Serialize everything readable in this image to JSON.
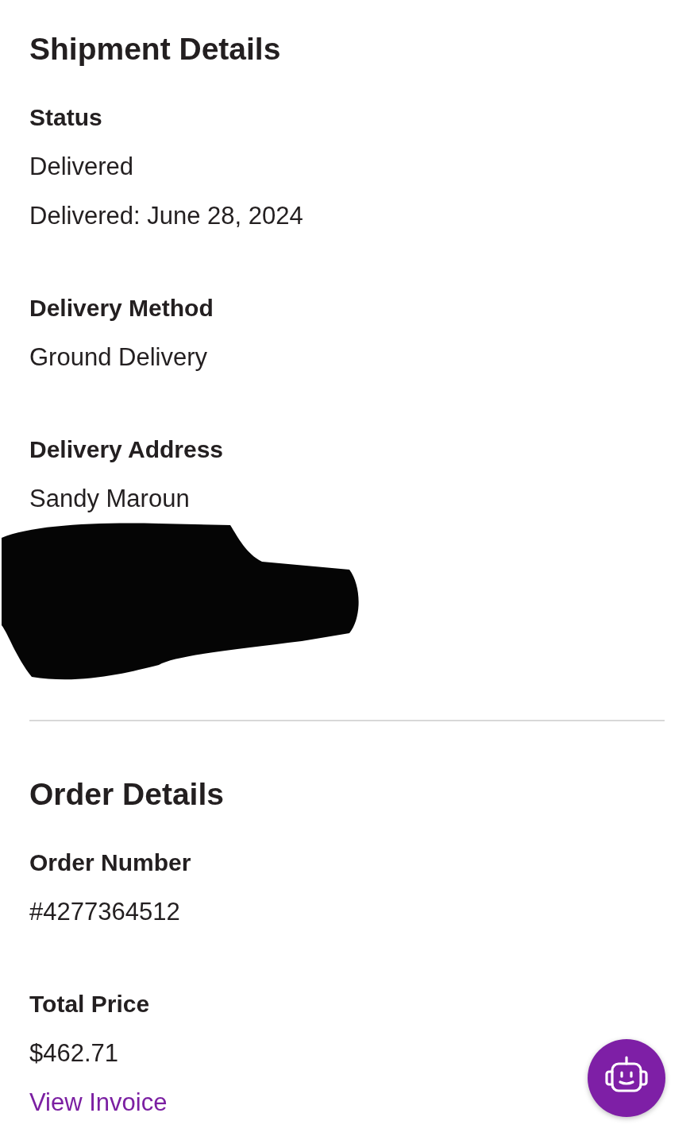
{
  "sections": [
    {
      "title": "Shipment Details",
      "fields": [
        {
          "label": "Status",
          "values": [
            "Delivered",
            "Delivered: June 28, 2024"
          ]
        },
        {
          "label": "Delivery Method",
          "values": [
            "Ground Delivery"
          ]
        },
        {
          "label": "Delivery Address",
          "values": [
            "Sandy Maroun"
          ],
          "redacted": true
        }
      ]
    },
    {
      "title": "Order Details",
      "fields": [
        {
          "label": "Order Number",
          "values": [
            "#4277364512"
          ]
        },
        {
          "label": "Total Price",
          "values": [
            "$462.71"
          ],
          "link": "View Invoice"
        }
      ]
    }
  ]
}
